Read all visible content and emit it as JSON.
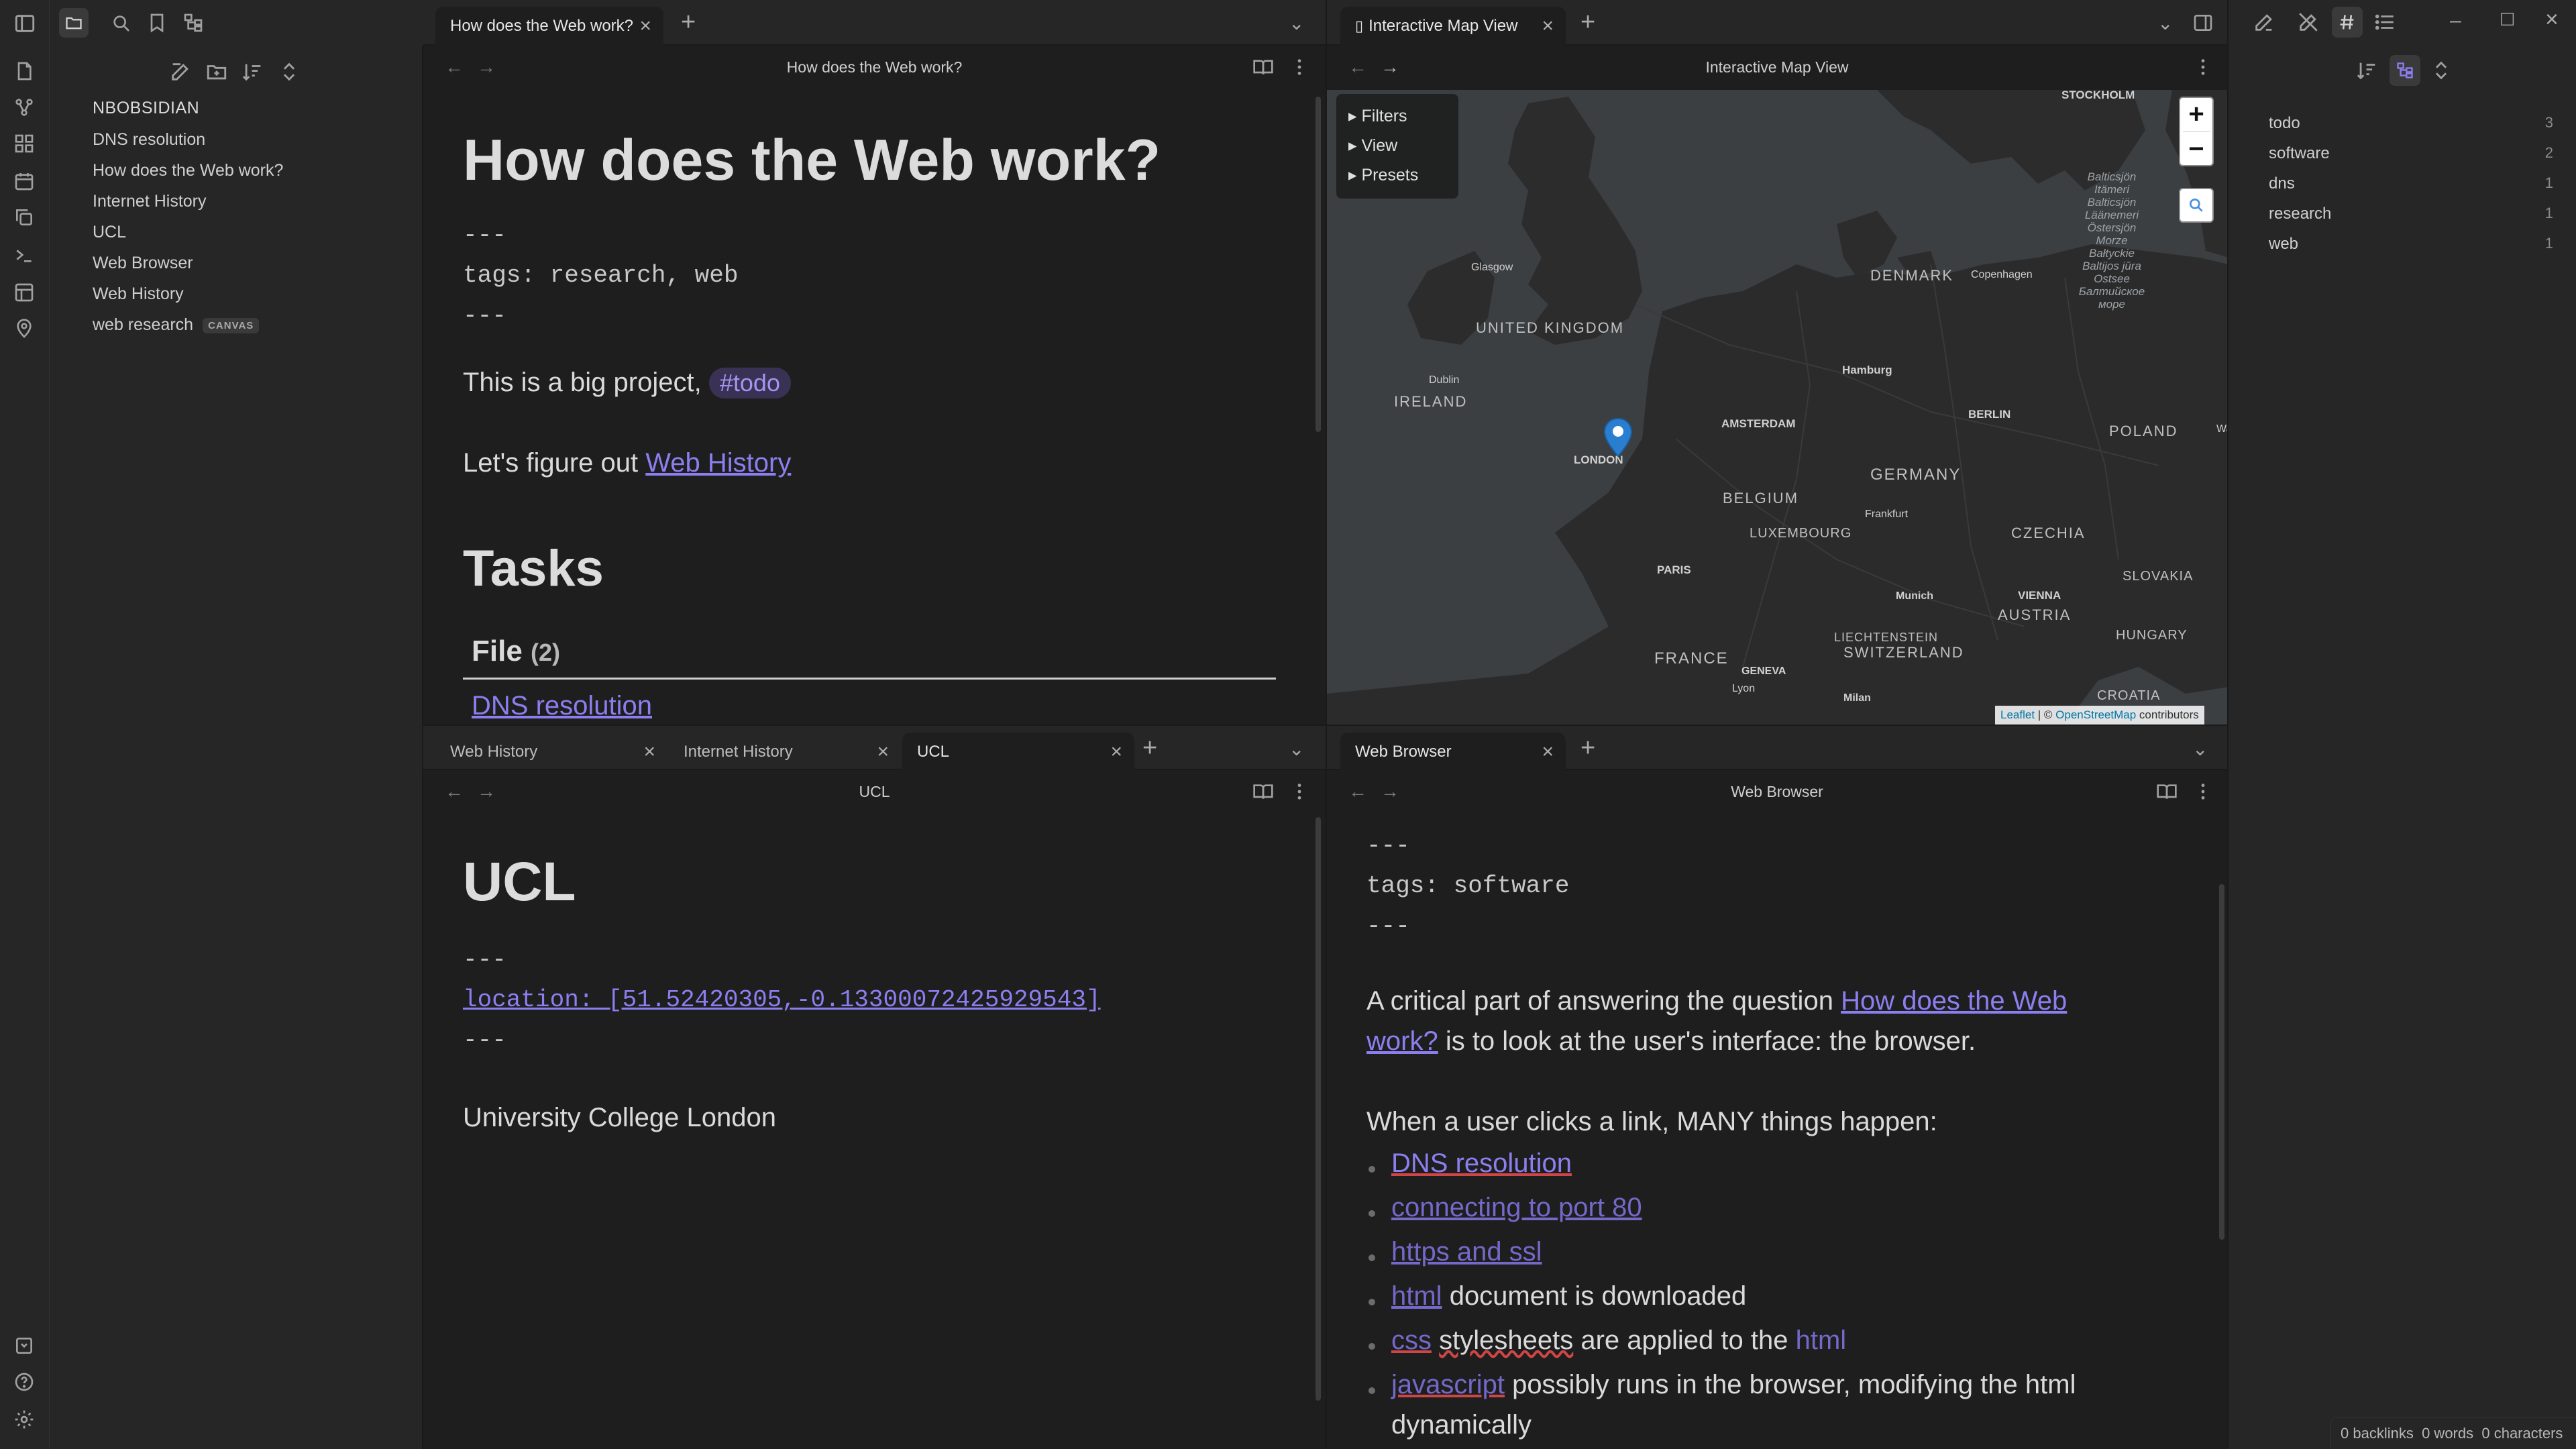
{
  "left_panel": {
    "vault_name": "NBOBSIDIAN",
    "files": [
      {
        "label": "DNS resolution"
      },
      {
        "label": "How does the Web work?"
      },
      {
        "label": "Internet History"
      },
      {
        "label": "UCL"
      },
      {
        "label": "Web Browser"
      },
      {
        "label": "Web History"
      },
      {
        "label": "web research",
        "badge": "CANVAS"
      }
    ]
  },
  "top_left": {
    "tabs": [
      {
        "label": "How does the Web work?",
        "active": true
      }
    ],
    "view_title": "How does the Web work?",
    "note": {
      "title": "How does the Web work?",
      "fm_open": "---",
      "fm_tags": "tags: research, web",
      "fm_close": "---",
      "para1_text": "This is a big project,",
      "para1_tag": "#todo",
      "para2_text": "Let's figure out",
      "para2_link": "Web History",
      "h_tasks": "Tasks",
      "h_file": "File",
      "file_count": "(2)",
      "file_link": "DNS resolution"
    }
  },
  "top_right": {
    "tabs": [
      {
        "label": "Interactive Map View",
        "active": true
      }
    ],
    "view_title": "Interactive Map View",
    "map": {
      "menu": [
        "Filters",
        "View",
        "Presets"
      ],
      "zoom_in": "+",
      "zoom_out": "−",
      "search_icon": "search-icon",
      "attribution_leaflet": "Leaflet",
      "attribution_sep": " | © ",
      "attribution_osm": "OpenStreetMap",
      "attribution_tail": " contributors",
      "labels": [
        {
          "text": "STOCKHOLM",
          "kind": "city"
        },
        {
          "text": "Glasgow",
          "kind": "city"
        },
        {
          "text": "UNITED KINGDOM",
          "kind": "country"
        },
        {
          "text": "DENMARK",
          "kind": "country"
        },
        {
          "text": "Copenhagen",
          "kind": "city"
        },
        {
          "text": "Dublin",
          "kind": "city"
        },
        {
          "text": "IRELAND",
          "kind": "country"
        },
        {
          "text": "Hamburg",
          "kind": "city"
        },
        {
          "text": "BERLIN",
          "kind": "city"
        },
        {
          "text": "POLAND",
          "kind": "country"
        },
        {
          "text": "Warsa",
          "kind": "city"
        },
        {
          "text": "AMSTERDAM",
          "kind": "city"
        },
        {
          "text": "LONDON",
          "kind": "city"
        },
        {
          "text": "GERMANY",
          "kind": "country"
        },
        {
          "text": "BELGIUM",
          "kind": "country"
        },
        {
          "text": "LUXEMBOURG",
          "kind": "country"
        },
        {
          "text": "Frankfurt",
          "kind": "city"
        },
        {
          "text": "CZECHIA",
          "kind": "country"
        },
        {
          "text": "PARIS",
          "kind": "city"
        },
        {
          "text": "SLOVAKIA",
          "kind": "country"
        },
        {
          "text": "Munich",
          "kind": "city"
        },
        {
          "text": "VIENNA",
          "kind": "city"
        },
        {
          "text": "AUSTRIA",
          "kind": "country"
        },
        {
          "text": "LIECHTENSTEIN",
          "kind": "country"
        },
        {
          "text": "SWITZERLAND",
          "kind": "country"
        },
        {
          "text": "HUNGARY",
          "kind": "country"
        },
        {
          "text": "FRANCE",
          "kind": "country"
        },
        {
          "text": "GENEVA",
          "kind": "city"
        },
        {
          "text": "Lyon",
          "kind": "city"
        },
        {
          "text": "Milan",
          "kind": "city"
        },
        {
          "text": "CROATIA",
          "kind": "country"
        }
      ],
      "baltic_lines": [
        "Balticsjön",
        "Itämeri",
        "Balticsjön",
        "Läänemeri",
        "Östersjön",
        "Morze",
        "Bałtyckie",
        "Baltijos jūra",
        "Ostsee",
        "Балтийское",
        "море"
      ]
    }
  },
  "bottom_left": {
    "tabs": [
      {
        "label": "Web History",
        "active": false
      },
      {
        "label": "Internet History",
        "active": false
      },
      {
        "label": "UCL",
        "active": true
      }
    ],
    "view_title": "UCL",
    "note": {
      "title": "UCL",
      "fm_open": "---",
      "fm_location": "location: [51.52420305,-0.13300072425929543]",
      "fm_close": "---",
      "body": "University College London"
    }
  },
  "bottom_right": {
    "tabs": [
      {
        "label": "Web Browser",
        "active": true
      }
    ],
    "view_title": "Web Browser",
    "note": {
      "fm_open": "---",
      "fm_tags": "tags: software",
      "fm_close": "---",
      "p1_a": "A critical part of answering the question ",
      "p1_link1": "How does the Web",
      "p1_link2": "work?",
      "p1_b": " is to look at the user's interface: the browser.",
      "p2": "When a user clicks a link, MANY things happen:",
      "li1_link": "DNS resolution",
      "li2_link": "connecting to port 80",
      "li3_link": "https and ssl",
      "li4_link": "html",
      "li4_text": " document is downloaded",
      "li5_link": "css",
      "li5_text_a": " ",
      "li5_word": "stylesheets",
      "li5_text_b": " are applied to the ",
      "li5_link2": "html",
      "li6_link": "javascript",
      "li6_text": " possibly runs in the browser, modifying the html",
      "li6_cont": "dynamically"
    }
  },
  "right_sidebar": {
    "tags": [
      {
        "name": "todo",
        "count": "3"
      },
      {
        "name": "software",
        "count": "2"
      },
      {
        "name": "dns",
        "count": "1"
      },
      {
        "name": "research",
        "count": "1"
      },
      {
        "name": "web",
        "count": "1"
      }
    ]
  },
  "status_bar": {
    "backlinks": "0 backlinks",
    "words": "0 words",
    "characters": "0 characters"
  },
  "colors": {
    "accent": "#8b7ff0",
    "background": "#1e1e1e",
    "sidebar": "#262626",
    "map_water": "#3b3f42",
    "map_land": "#2b2b2b"
  }
}
